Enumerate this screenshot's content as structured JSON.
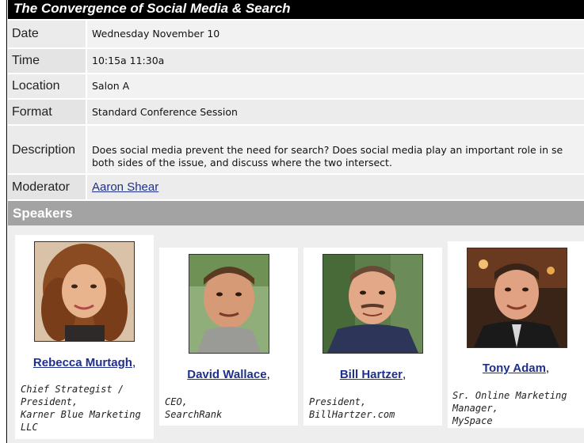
{
  "session": {
    "title": "The Convergence of Social Media & Search",
    "date_label": "Date",
    "date_value": "Wednesday November 10",
    "time_label": "Time",
    "time_value": "10:15a 11:30a",
    "location_label": "Location",
    "location_value": "Salon A",
    "format_label": "Format",
    "format_value": "Standard Conference Session",
    "description_label": "Description",
    "description_line1": "Does social media prevent the need for search? Does social media play an important role in se",
    "description_line2": "both sides of the issue, and discuss where the two intersect.",
    "moderator_label": "Moderator",
    "moderator_value": "Aaron Shear"
  },
  "speakers": {
    "heading": "Speakers",
    "items": [
      {
        "name": "Rebecca Murtagh",
        "role": "Chief Strategist /\nPresident,\nKarner Blue Marketing\nLLC"
      },
      {
        "name": "David Wallace",
        "role": "CEO,\nSearchRank"
      },
      {
        "name": "Bill Hartzer",
        "role": "President,\nBillHartzer.com"
      },
      {
        "name": "Tony Adam",
        "role": "Sr. Online Marketing\nManager,\nMySpace"
      }
    ]
  },
  "separator": ","
}
